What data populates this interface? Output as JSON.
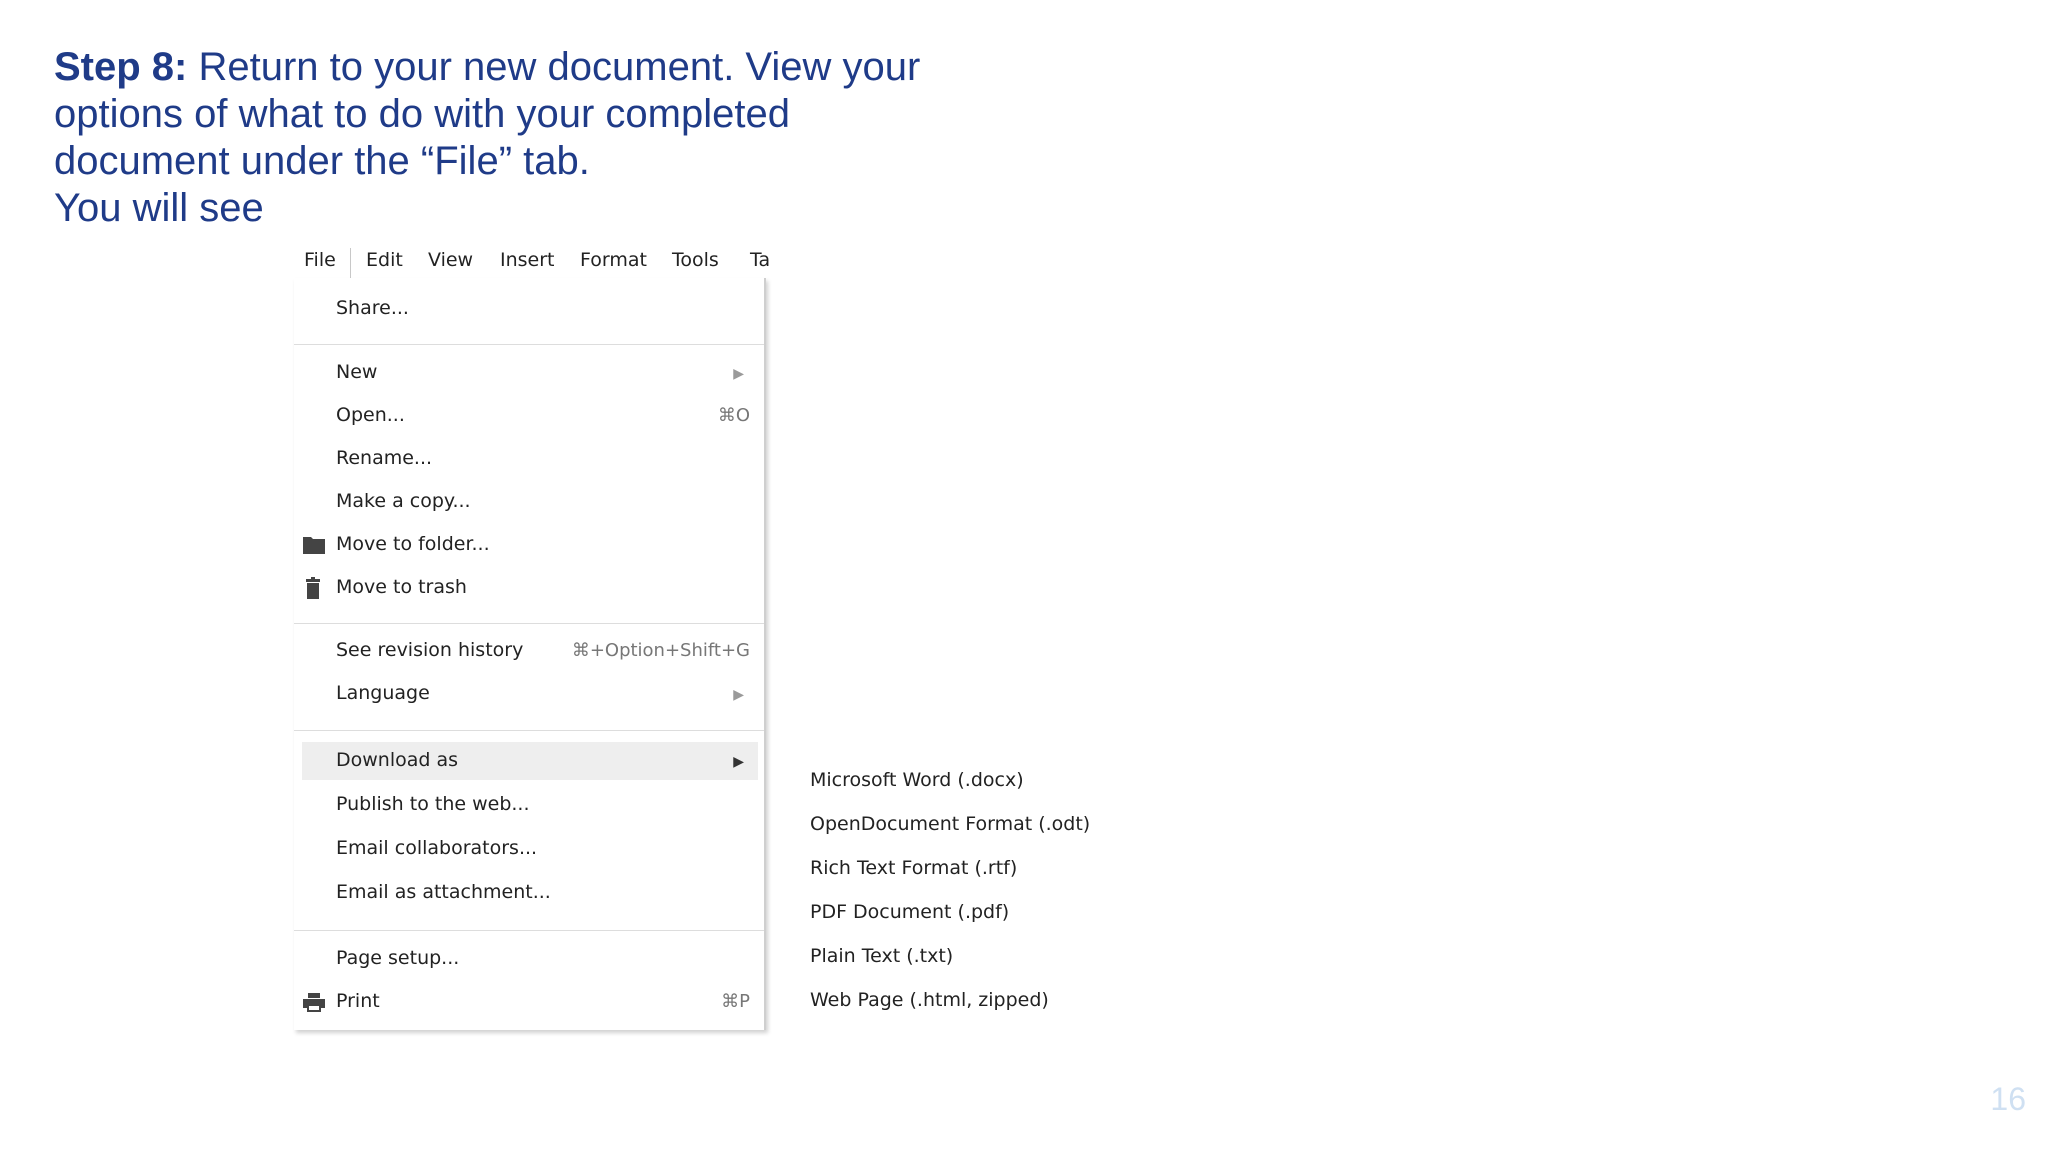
{
  "instructions": {
    "step_label": "Step 8:",
    "line1_rest": " Return to your new document. View your",
    "line2": "options of what to do with your completed",
    "line3": "document under the “File” tab.",
    "line4": "You will see"
  },
  "menubar": {
    "items": [
      "File",
      "Edit",
      "View",
      "Insert",
      "Format",
      "Tools",
      "Ta"
    ]
  },
  "file_menu": {
    "share": "Share...",
    "new": "New",
    "open": "Open...",
    "open_shortcut": "⌘O",
    "rename": "Rename...",
    "make_copy": "Make a copy...",
    "move_to_folder": "Move to folder...",
    "move_to_trash": "Move to trash",
    "see_revision_history": "See revision history",
    "revision_shortcut": "⌘+Option+Shift+G",
    "language": "Language",
    "download_as": "Download as",
    "publish": "Publish to the web...",
    "email_collaborators": "Email collaborators...",
    "email_attachment": "Email as attachment...",
    "page_setup": "Page setup...",
    "print": "Print",
    "print_shortcut": "⌘P",
    "submenu_arrow": "▶"
  },
  "download_submenu": {
    "items": [
      "Microsoft Word (.docx)",
      "OpenDocument Format (.odt)",
      "Rich Text Format (.rtf)",
      "PDF Document (.pdf)",
      "Plain Text (.txt)",
      "Web Page (.html, zipped)"
    ]
  },
  "icons": {
    "folder": "folder-icon",
    "trash": "trash-icon",
    "print": "printer-icon"
  },
  "page_number": "16",
  "colors": {
    "heading_text": "#1f3b88",
    "highlight": "#eeeeee",
    "page_number": "#cfe0f2"
  }
}
